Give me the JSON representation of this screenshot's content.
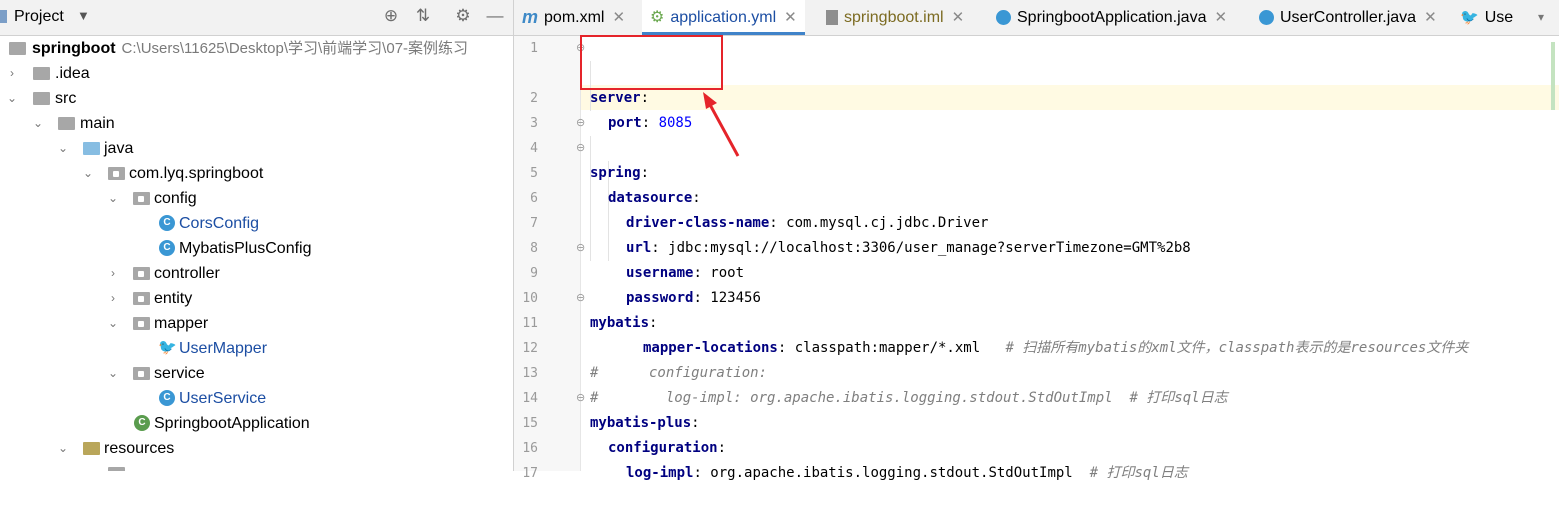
{
  "project": {
    "title": "Project",
    "root_label": "springboot",
    "root_path": "C:\\Users\\11625\\Desktop\\学习\\前端学习\\07-案例练习",
    "tree": [
      {
        "label": "springboot"
      },
      {
        "label": ".idea"
      },
      {
        "label": "src"
      },
      {
        "label": "main"
      },
      {
        "label": "java"
      },
      {
        "label": "com.lyq.springboot"
      },
      {
        "label": "config"
      },
      {
        "label": "CorsConfig"
      },
      {
        "label": "MybatisPlusConfig"
      },
      {
        "label": "controller"
      },
      {
        "label": "entity"
      },
      {
        "label": "mapper"
      },
      {
        "label": "UserMapper"
      },
      {
        "label": "service"
      },
      {
        "label": "UserService"
      },
      {
        "label": "SpringbootApplication"
      },
      {
        "label": "resources"
      }
    ]
  },
  "tabs": [
    {
      "label": "pom.xml"
    },
    {
      "label": "application.yml"
    },
    {
      "label": "springboot.iml"
    },
    {
      "label": "SpringbootApplication.java"
    },
    {
      "label": "UserController.java"
    },
    {
      "label": "Use"
    }
  ],
  "editor": {
    "lines": [
      {
        "n": "1",
        "key": "server",
        "val": ""
      },
      {
        "n": "2",
        "key": "port",
        "val": "8085"
      },
      {
        "n": "3",
        "key": "",
        "val": ""
      },
      {
        "n": "4",
        "key": "spring",
        "val": ""
      },
      {
        "n": "5",
        "key": "datasource",
        "val": ""
      },
      {
        "n": "6",
        "key": "driver-class-name",
        "val": "com.mysql.cj.jdbc.Driver"
      },
      {
        "n": "7",
        "key": "url",
        "val": "jdbc:mysql://localhost:3306/user_manage?serverTimezone=GMT%2b8"
      },
      {
        "n": "8",
        "key": "username",
        "val": "root"
      },
      {
        "n": "9",
        "key": "password",
        "val": "123456"
      },
      {
        "n": "10",
        "key": "mybatis",
        "val": ""
      },
      {
        "n": "11",
        "key": "mapper-locations",
        "val": "classpath:mapper/*.xml",
        "comment": "# 扫描所有mybatis的xml文件，classpath表示的是resources文件夹"
      },
      {
        "n": "12",
        "comment": "#      configuration:"
      },
      {
        "n": "13",
        "comment": "#        log-impl: org.apache.ibatis.logging.stdout.StdOutImpl  # 打印sql日志"
      },
      {
        "n": "14",
        "key": "mybatis-plus",
        "val": ""
      },
      {
        "n": "15",
        "key": "configuration",
        "val": ""
      },
      {
        "n": "16",
        "key": "log-impl",
        "val": "org.apache.ibatis.logging.stdout.StdOutImpl",
        "comment": "# 打印sql日志"
      },
      {
        "n": "17",
        "key": "",
        "val": ""
      }
    ]
  }
}
